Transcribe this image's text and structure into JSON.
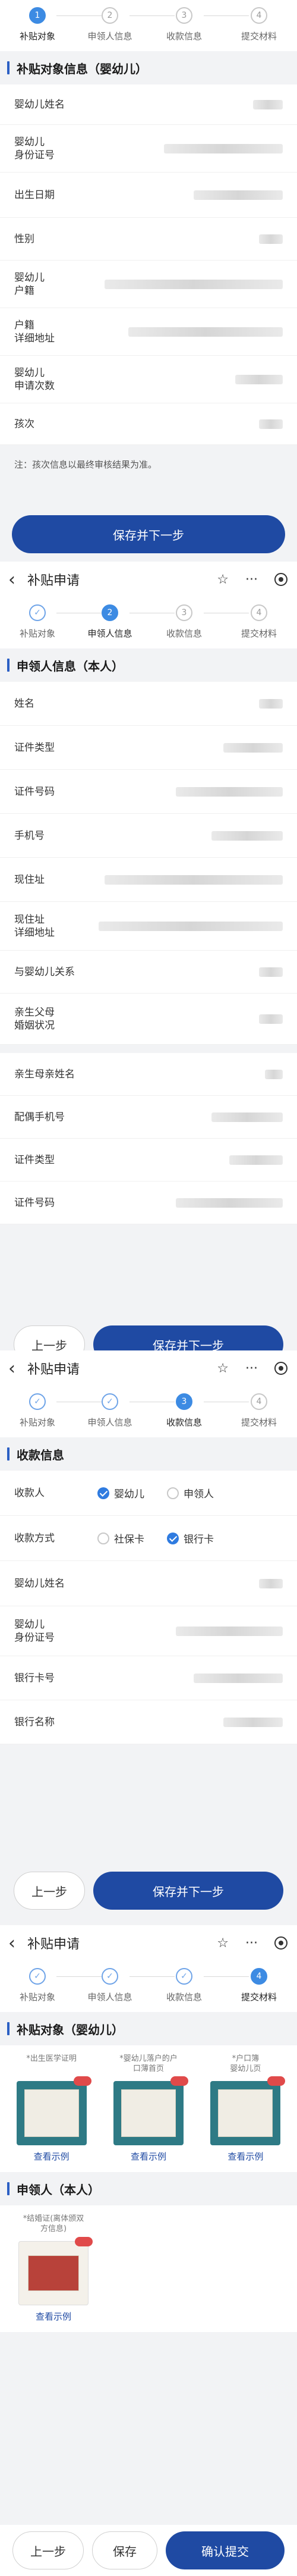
{
  "nav": {
    "back": "‹",
    "title": "补贴申请",
    "star": "☆",
    "more": "···"
  },
  "steps": [
    {
      "num": "1",
      "label": "补贴对象",
      "done_mark": "✓"
    },
    {
      "num": "2",
      "label": "申领人信息",
      "done_mark": "✓"
    },
    {
      "num": "3",
      "label": "收款信息",
      "done_mark": "✓"
    },
    {
      "num": "4",
      "label": "提交材料"
    }
  ],
  "s1": {
    "section": "补贴对象信息（婴幼儿）",
    "rows": [
      "婴幼儿姓名",
      "婴幼儿\n身份证号",
      "出生日期",
      "性别",
      "婴幼儿\n户籍",
      "户籍\n详细地址",
      "婴幼儿\n申请次数",
      "孩次"
    ],
    "note": "注：孩次信息以最终审核结果为准。",
    "button": "保存并下一步"
  },
  "s2": {
    "section": "申领人信息（本人）",
    "rows": [
      "姓名",
      "证件类型",
      "证件号码",
      "手机号",
      "现住址",
      "现住址\n详细地址",
      "与婴幼儿关系",
      "亲生父母\n婚姻状况",
      "亲生母亲姓名",
      "配偶手机号",
      "证件类型",
      "证件号码"
    ],
    "prev": "上一步",
    "button": "保存并下一步"
  },
  "s3": {
    "section": "收款信息",
    "payee_label": "收款人",
    "payee_options": [
      "婴幼儿",
      "申领人"
    ],
    "method_label": "收款方式",
    "method_options": [
      "社保卡",
      "银行卡"
    ],
    "rows": [
      "婴幼儿姓名",
      "婴幼儿\n身份证号",
      "银行卡号",
      "银行名称"
    ],
    "prev": "上一步",
    "button": "保存并下一步"
  },
  "s4": {
    "section": "补贴对象（婴幼儿）",
    "uploads": [
      {
        "caption": "*出生医学证明",
        "example": "查看示例"
      },
      {
        "caption": "*婴幼儿落户的户\n口薄首页",
        "example": "查看示例"
      },
      {
        "caption": "*户口簿\n婴幼儿页",
        "example": "查看示例"
      }
    ],
    "section2": "申领人（本人）",
    "uploads2": [
      {
        "caption": "*结婚证(离体颁双\n方信息)",
        "example": "查看示例"
      }
    ],
    "prev": "上一步",
    "save": "保存",
    "submit": "确认提交"
  }
}
